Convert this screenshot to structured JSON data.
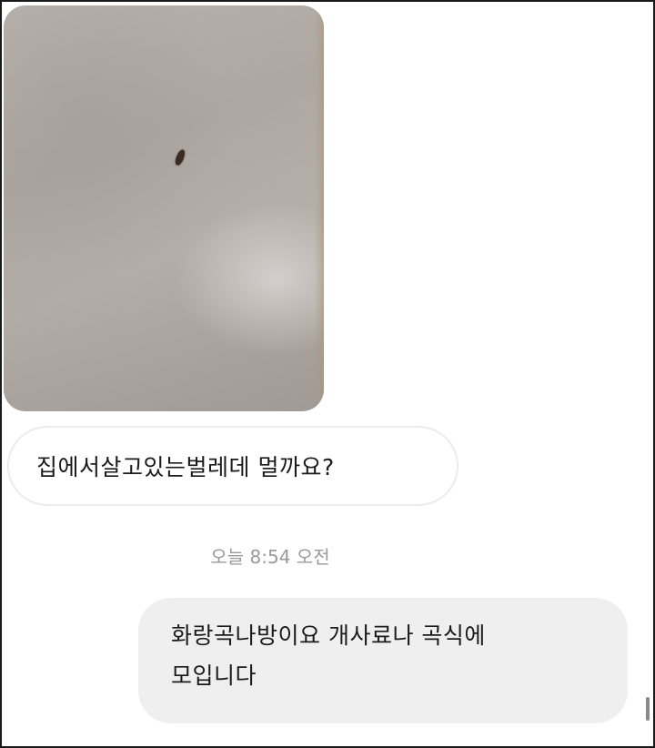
{
  "conversation": {
    "messages": [
      {
        "direction": "incoming",
        "type": "image",
        "image_description": "photo of a small bug on a beige wall"
      },
      {
        "direction": "incoming",
        "type": "text",
        "text": "집에서살고있는벌레데 멀까요?"
      },
      {
        "type": "timestamp",
        "text": "오늘 8:54 오전"
      },
      {
        "direction": "outgoing",
        "type": "text",
        "lines": [
          "화랑곡나방이요 개사료나 곡식에",
          "모입니다"
        ]
      }
    ]
  },
  "colors": {
    "incoming_bubble": "#ffffff",
    "outgoing_bubble": "#efefef",
    "timestamp": "#9a9a9a",
    "text": "#1b1b1b"
  }
}
